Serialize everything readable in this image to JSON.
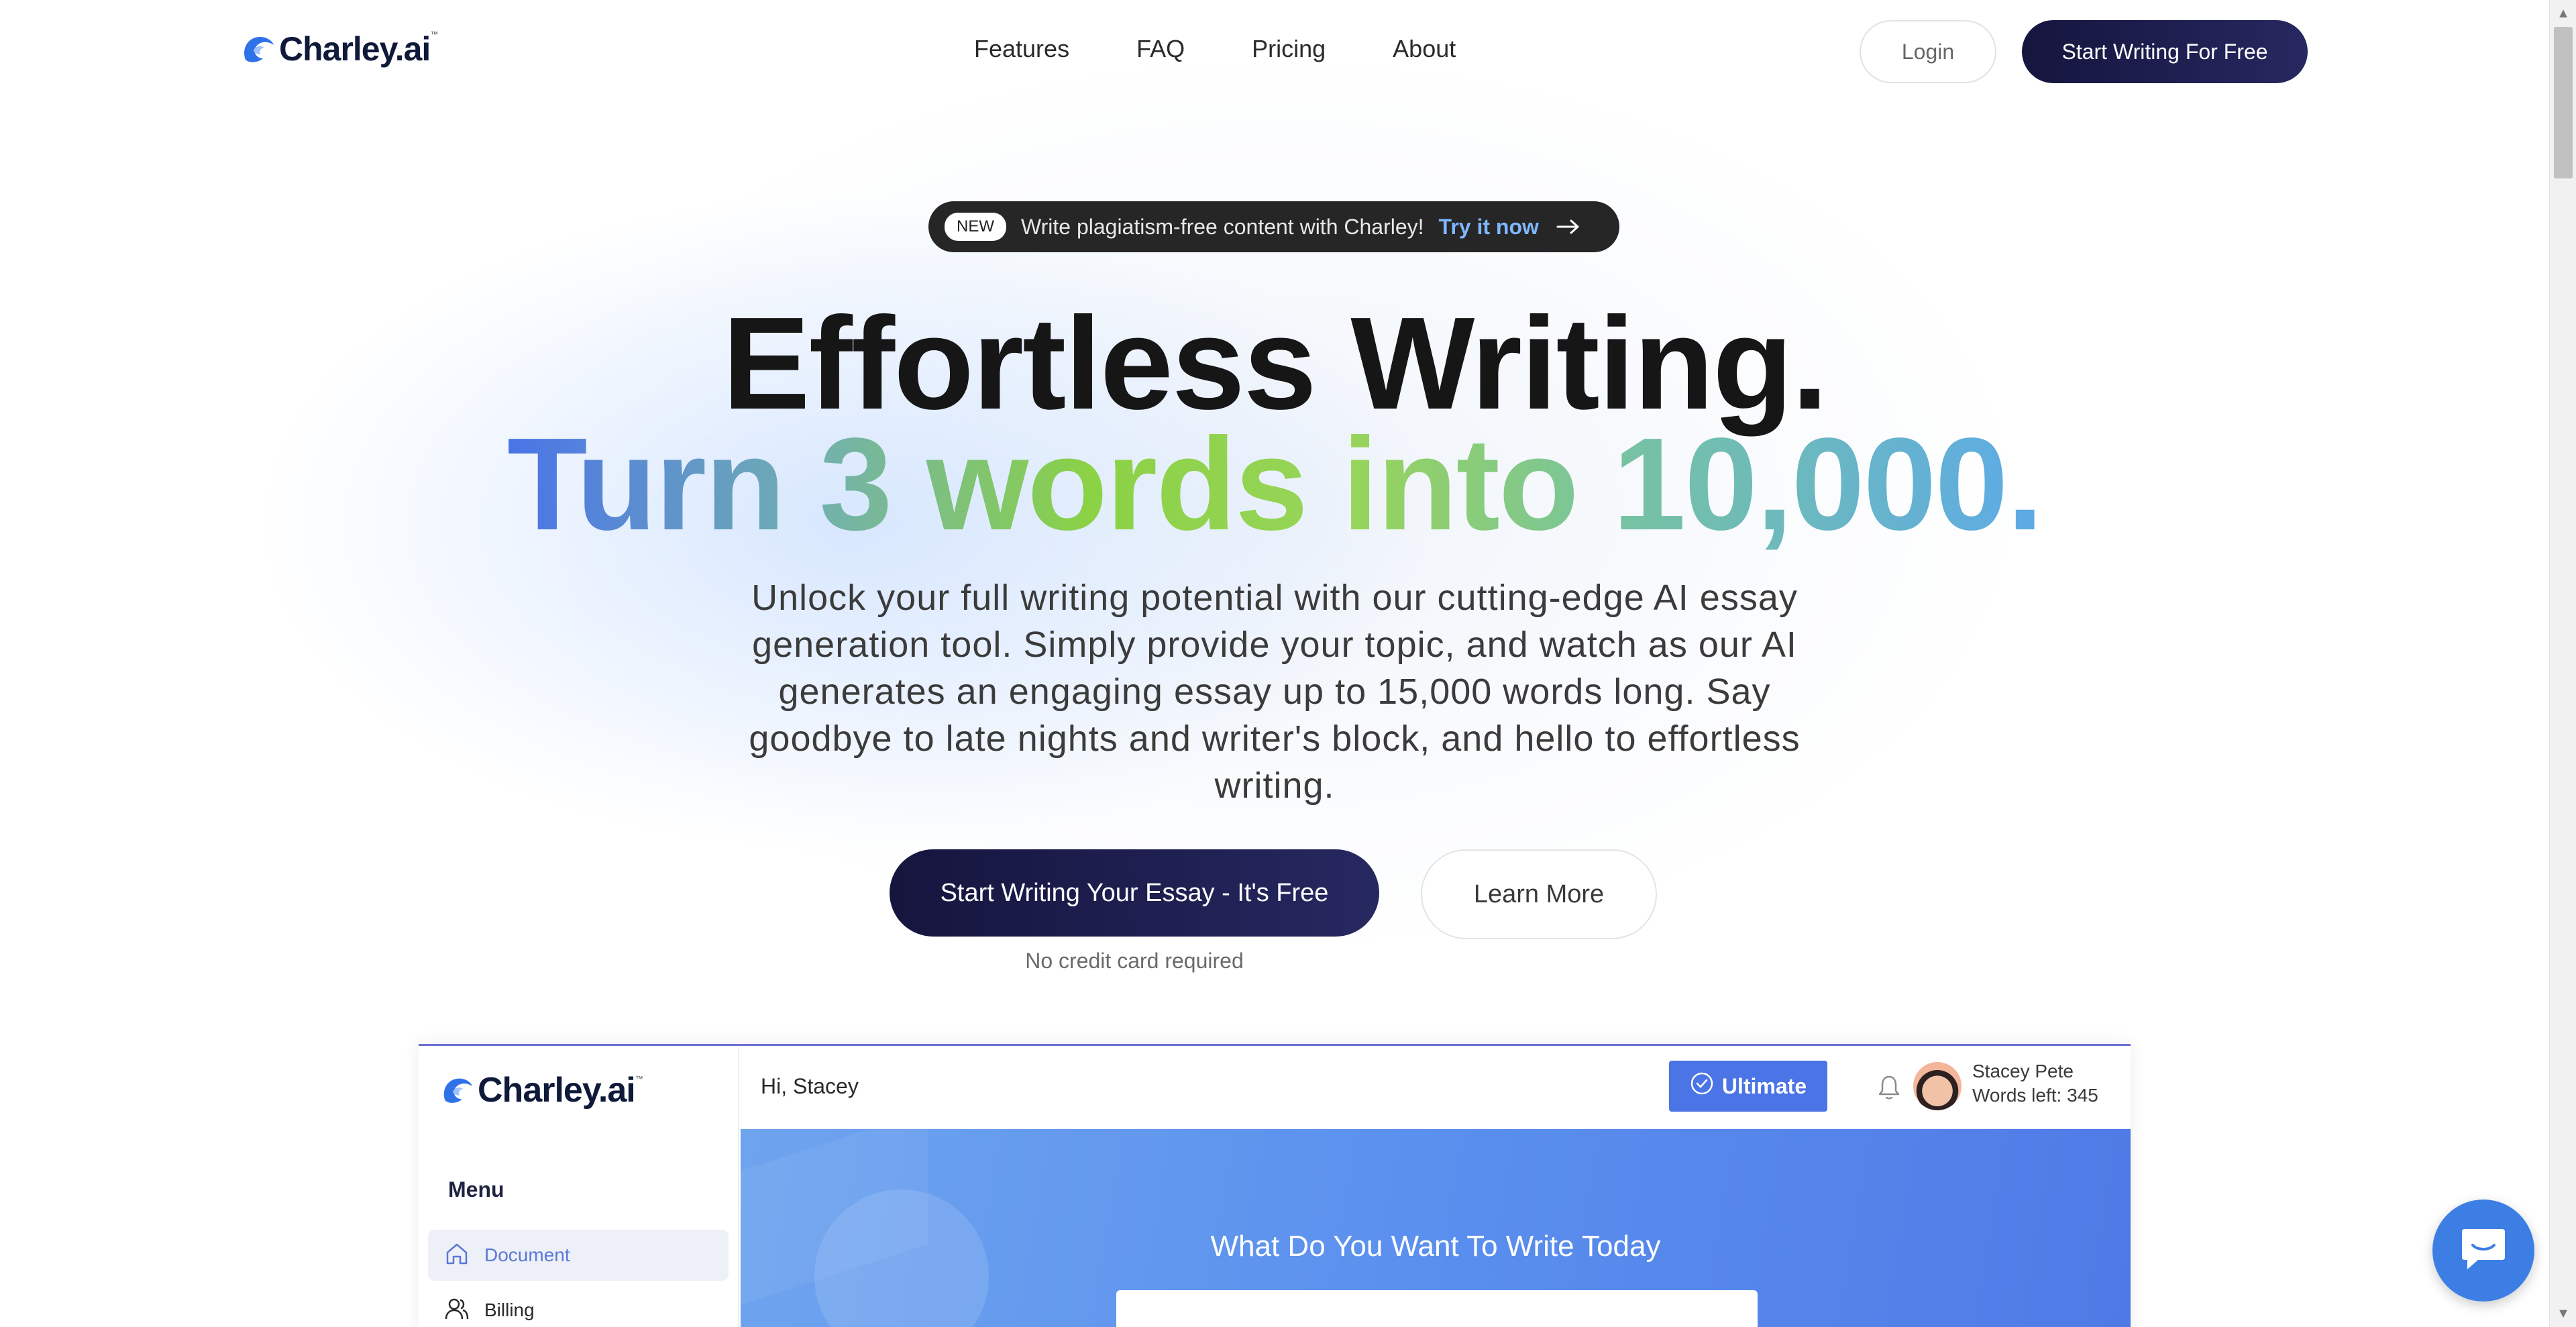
{
  "brand": {
    "name": "Charley.ai",
    "tm": "™"
  },
  "nav": {
    "links": [
      "Features",
      "FAQ",
      "Pricing",
      "About"
    ],
    "login": "Login",
    "start": "Start Writing For Free"
  },
  "announcement": {
    "tag": "NEW",
    "text": "Write plagiatism-free content with Charley!",
    "cta": "Try it now",
    "arrow_icon": "arrow-right-icon"
  },
  "hero": {
    "line1": "Effortless Writing.",
    "line2": "Turn 3 words into 10,000.",
    "subtitle": "Unlock your full writing potential with our cutting-edge AI essay generation tool. Simply provide your topic, and watch as our AI generates an engaging essay up to 15,000 words long. Say goodbye to late nights and writer's block, and hello to effortless writing.",
    "cta_primary": "Start Writing Your Essay - It's Free",
    "cta_secondary": "Learn More",
    "note": "No credit card required"
  },
  "app_preview": {
    "greeting": "Hi, Stacey",
    "plan_button": "Ultimate",
    "user_name": "Stacey Pete",
    "words_left": "Words left: 345",
    "menu_title": "Menu",
    "menu_items": [
      "Document",
      "Billing"
    ],
    "prompt": "What Do You Want To Write Today"
  },
  "colors": {
    "primary_dark": "#1a1a4a",
    "accent_blue": "#4b74e6",
    "chat_blue": "#3d7ee5"
  }
}
